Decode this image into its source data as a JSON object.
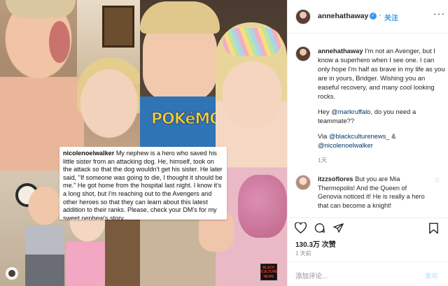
{
  "post": {
    "username": "annehathaway",
    "follow_label": "关注",
    "caption_author": "annehathaway",
    "caption_parts": [
      {
        "type": "text",
        "value": " I'm not an Avenger, but I know a superhero when I see one. I can only hope I'm half as brave in my life as you are in yours, Bridger. Wishing you an easeful recovery, and many cool looking rocks."
      },
      {
        "type": "break"
      },
      {
        "type": "text",
        "value": "Hey "
      },
      {
        "type": "link",
        "value": "@markruffalo"
      },
      {
        "type": "text",
        "value": ", do you need a teammate??"
      },
      {
        "type": "break"
      },
      {
        "type": "text",
        "value": "Via "
      },
      {
        "type": "link",
        "value": "@blackculturenews_"
      },
      {
        "type": "text",
        "value": " & "
      },
      {
        "type": "link",
        "value": "@nicolenoelwalker"
      }
    ],
    "caption_time": "1天",
    "likes": "130.3万 次赞",
    "time_ago": "1 天前",
    "add_comment_placeholder": "添加评论...",
    "post_button": "发布"
  },
  "comment": {
    "username": "itzzsoflores",
    "text": " But you are Mia Thermopolis! And the Queen of Genovia noticed it! He is really a hero that can become a knight!"
  },
  "image_caption": {
    "author": "nicolenoelwalker",
    "text": " My nephew is a hero who saved his little sister from an attacking dog.  He, himself, took on the attack so that the dog wouldn't get his sister. He later said, \"If someone was going to die, I thought it should be me.\" He got home from the hospital last night.  I know it's a long shot, but I'm reaching out to the Avengers and other heroes so that they can learn about this latest addition to their ranks.  Please, check your DM's for my sweet nephew's story."
  },
  "shirt_text": "POKéMO",
  "watermark": {
    "line1": "BLACK",
    "line2": "CULTURE",
    "line3": "NEWS"
  },
  "icons": {
    "verified": "verified-badge-icon",
    "more": "more-options-icon",
    "heart": "heart-icon",
    "comment": "comment-icon",
    "share": "share-icon",
    "save": "bookmark-icon"
  },
  "colors": {
    "link": "#00376b",
    "accent": "#3897f0",
    "muted": "#8e8e8e"
  }
}
